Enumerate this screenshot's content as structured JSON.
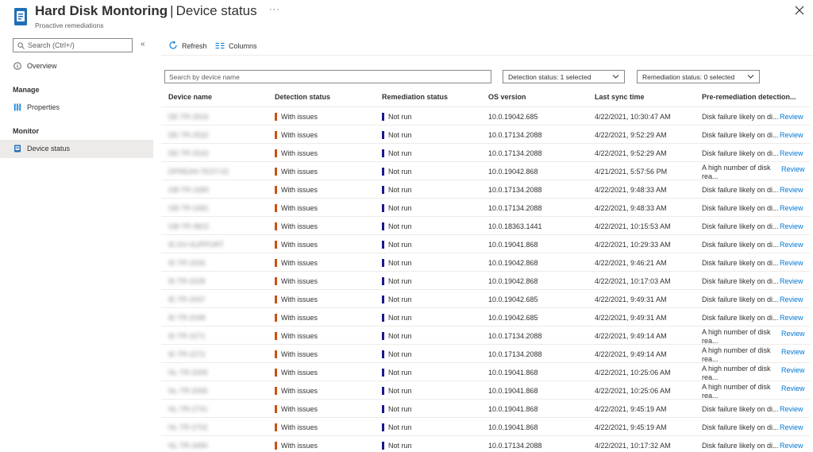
{
  "header": {
    "app_title": "Hard Disk Montoring",
    "page_title": "Device status",
    "subtitle": "Proactive remediations",
    "more_label": "···"
  },
  "sidebar": {
    "search_placeholder": "Search (Ctrl+/)",
    "collapse_label": "«",
    "items": [
      {
        "label": "Overview",
        "icon": "overview-icon"
      },
      {
        "label": "Properties",
        "icon": "properties-icon"
      },
      {
        "label": "Device status",
        "icon": "device-status-icon"
      }
    ],
    "sections": [
      "Manage",
      "Monitor"
    ]
  },
  "toolbar": {
    "refresh_label": "Refresh",
    "columns_label": "Columns"
  },
  "filters": {
    "search_placeholder": "Search by device name",
    "detection_status": "Detection status: 1 selected",
    "remediation_status": "Remediation status: 0 selected"
  },
  "colors": {
    "accent": "#0078d4",
    "with_issues": "#ca5010",
    "not_run": "#1a1a8c"
  },
  "table": {
    "columns": [
      "Device name",
      "Detection status",
      "Remediation status",
      "OS version",
      "Last sync time",
      "Pre-remediation detection..."
    ],
    "review_label": "Review",
    "rows": [
      {
        "device": "DE-TR-2516",
        "detection": "With issues",
        "remediation": "Not run",
        "os": "10.0.19042.685",
        "sync": "4/22/2021, 10:30:47 AM",
        "pre": "Disk failure likely on di..."
      },
      {
        "device": "DE-TR-2532",
        "detection": "With issues",
        "remediation": "Not run",
        "os": "10.0.17134.2088",
        "sync": "4/22/2021, 9:52:29 AM",
        "pre": "Disk failure likely on di..."
      },
      {
        "device": "DE-TR-2533",
        "detection": "With issues",
        "remediation": "Not run",
        "os": "10.0.17134.2088",
        "sync": "4/22/2021, 9:52:29 AM",
        "pre": "Disk failure likely on di..."
      },
      {
        "device": "DPREAN-TEST-02",
        "detection": "With issues",
        "remediation": "Not run",
        "os": "10.0.19042.868",
        "sync": "4/21/2021, 5:57:56 PM",
        "pre": "A high number of disk rea..."
      },
      {
        "device": "GB-TR-1680",
        "detection": "With issues",
        "remediation": "Not run",
        "os": "10.0.17134.2088",
        "sync": "4/22/2021, 9:48:33 AM",
        "pre": "Disk failure likely on di..."
      },
      {
        "device": "GB-TR-1681",
        "detection": "With issues",
        "remediation": "Not run",
        "os": "10.0.17134.2088",
        "sync": "4/22/2021, 9:48:33 AM",
        "pre": "Disk failure likely on di..."
      },
      {
        "device": "GB-TR-3822",
        "detection": "With issues",
        "remediation": "Not run",
        "os": "10.0.18363.1441",
        "sync": "4/22/2021, 10:15:53 AM",
        "pre": "Disk failure likely on di..."
      },
      {
        "device": "IE-DV-SUPPORT",
        "detection": "With issues",
        "remediation": "Not run",
        "os": "10.0.19041.868",
        "sync": "4/22/2021, 10:29:33 AM",
        "pre": "Disk failure likely on di..."
      },
      {
        "device": "IE-TR-2026",
        "detection": "With issues",
        "remediation": "Not run",
        "os": "10.0.19042.868",
        "sync": "4/22/2021, 9:46:21 AM",
        "pre": "Disk failure likely on di..."
      },
      {
        "device": "IE-TR-2028",
        "detection": "With issues",
        "remediation": "Not run",
        "os": "10.0.19042.868",
        "sync": "4/22/2021, 10:17:03 AM",
        "pre": "Disk failure likely on di..."
      },
      {
        "device": "IE-TR-2047",
        "detection": "With issues",
        "remediation": "Not run",
        "os": "10.0.19042.685",
        "sync": "4/22/2021, 9:49:31 AM",
        "pre": "Disk failure likely on di..."
      },
      {
        "device": "IE-TR-2048",
        "detection": "With issues",
        "remediation": "Not run",
        "os": "10.0.19042.685",
        "sync": "4/22/2021, 9:49:31 AM",
        "pre": "Disk failure likely on di..."
      },
      {
        "device": "IE-TR-2271",
        "detection": "With issues",
        "remediation": "Not run",
        "os": "10.0.17134.2088",
        "sync": "4/22/2021, 9:49:14 AM",
        "pre": "A high number of disk rea..."
      },
      {
        "device": "IE-TR-2272",
        "detection": "With issues",
        "remediation": "Not run",
        "os": "10.0.17134.2088",
        "sync": "4/22/2021, 9:49:14 AM",
        "pre": "A high number of disk rea..."
      },
      {
        "device": "NL-TR-2005",
        "detection": "With issues",
        "remediation": "Not run",
        "os": "10.0.19041.868",
        "sync": "4/22/2021, 10:25:06 AM",
        "pre": "A high number of disk rea..."
      },
      {
        "device": "NL-TR-2006",
        "detection": "With issues",
        "remediation": "Not run",
        "os": "10.0.19041.868",
        "sync": "4/22/2021, 10:25:06 AM",
        "pre": "A high number of disk rea..."
      },
      {
        "device": "NL-TR-2701",
        "detection": "With issues",
        "remediation": "Not run",
        "os": "10.0.19041.868",
        "sync": "4/22/2021, 9:45:19 AM",
        "pre": "Disk failure likely on di..."
      },
      {
        "device": "NL-TR-2702",
        "detection": "With issues",
        "remediation": "Not run",
        "os": "10.0.19041.868",
        "sync": "4/22/2021, 9:45:19 AM",
        "pre": "Disk failure likely on di..."
      },
      {
        "device": "NL-TR-3490",
        "detection": "With issues",
        "remediation": "Not run",
        "os": "10.0.17134.2088",
        "sync": "4/22/2021, 10:17:32 AM",
        "pre": "Disk failure likely on di..."
      }
    ]
  }
}
